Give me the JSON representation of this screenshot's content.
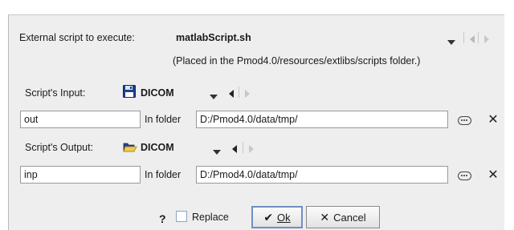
{
  "script": {
    "label": "External script to execute:",
    "name": "matlabScript.sh",
    "note": "(Placed in the Pmod4.0/resources/extlibs/scripts folder.)"
  },
  "input": {
    "label": "Script's Input:",
    "format": "DICOM",
    "name_value": "out",
    "folder_label": "In folder",
    "folder_value": "D:/Pmod4.0/data/tmp/"
  },
  "output": {
    "label": "Script's Output:",
    "format": "DICOM",
    "name_value": "inp",
    "folder_label": "In folder",
    "folder_value": "D:/Pmod4.0/data/tmp/"
  },
  "footer": {
    "help": "?",
    "replace_label": "Replace",
    "ok_label": "Ok",
    "cancel_label": "Cancel"
  },
  "icons": {
    "save": "floppy-disk-icon",
    "open": "open-folder-icon",
    "browse": "ellipsis-icon",
    "clear": "close-icon"
  }
}
